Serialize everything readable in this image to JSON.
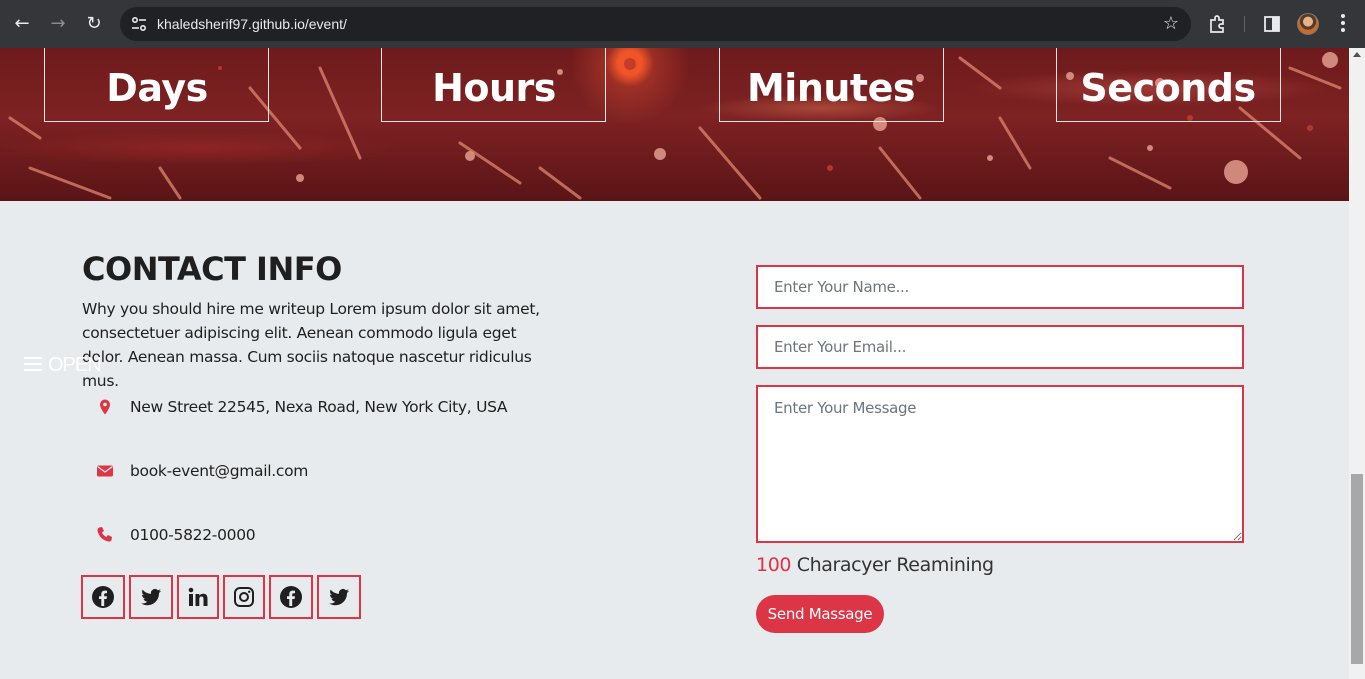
{
  "browser": {
    "url": "khaledsherif97.github.io/event/",
    "back_icon": "←",
    "forward_icon": "→",
    "reload_icon": "↻",
    "star_icon": "☆"
  },
  "countdown": {
    "units": [
      {
        "label": "Days"
      },
      {
        "label": "Hours"
      },
      {
        "label": "Minutes"
      },
      {
        "label": "Seconds"
      }
    ]
  },
  "menu": {
    "open_label": "OPEN"
  },
  "contact": {
    "title": "CONTACT INFO",
    "description": "Why you should hire me writeup Lorem ipsum dolor sit amet, consectetuer adipiscing elit. Aenean commodo ligula eget dolor. Aenean massa. Cum sociis natoque nascetur ridiculus mus.",
    "address": "New Street 22545, Nexa Road, New York City, USA",
    "email": "book-event@gmail.com",
    "phone": "0100-5822-0000",
    "social": [
      "facebook-icon",
      "twitter-icon",
      "linkedin-icon",
      "instagram-icon",
      "facebook-icon",
      "twitter-icon"
    ]
  },
  "form": {
    "name_placeholder": "Enter Your Name...",
    "email_placeholder": "Enter Your Email...",
    "message_placeholder": "Enter Your Message",
    "remaining_count": "100",
    "remaining_label": "Characyer Reamining",
    "send_label": "Send Massage"
  },
  "colors": {
    "accent": "#dc3545",
    "page_bg": "#e8ebee",
    "hero_bg": "#6e1a1c"
  }
}
